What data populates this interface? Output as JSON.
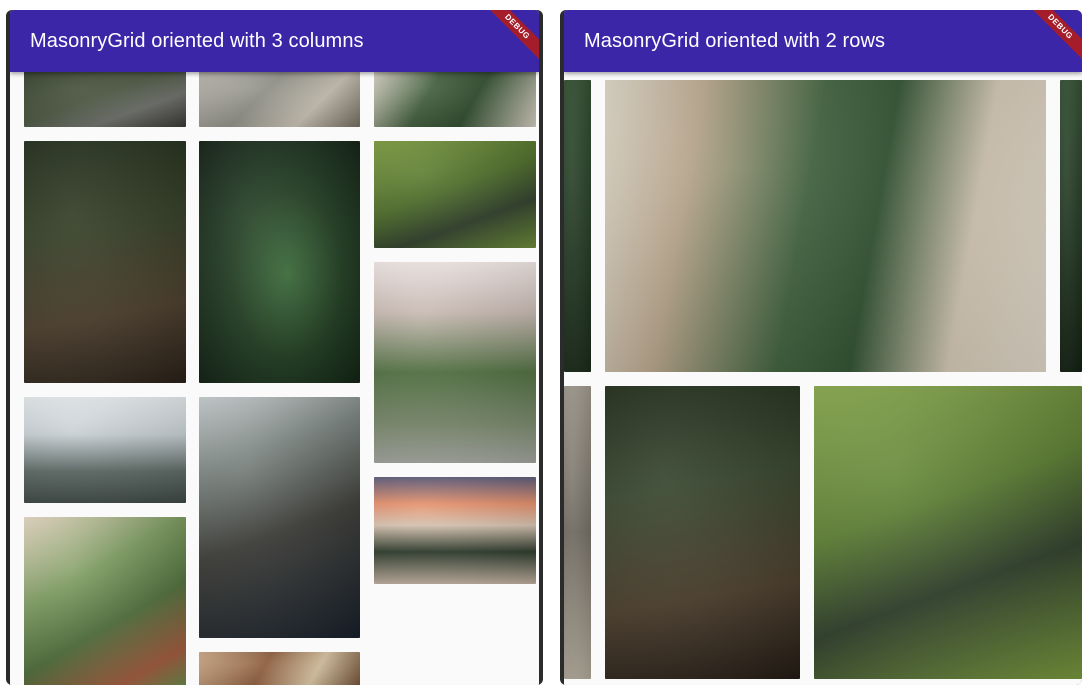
{
  "left_phone": {
    "appbar": {
      "title": "MasonryGrid oriented with 3 columns"
    },
    "debug_banner": "DEBUG",
    "tiles": [
      {
        "id": "road",
        "icon": "photo-road"
      },
      {
        "id": "hiker",
        "icon": "photo-hiker"
      },
      {
        "id": "shelf-plants",
        "icon": "photo-shelf-plants"
      },
      {
        "id": "motorbike",
        "icon": "photo-motorbike"
      },
      {
        "id": "fern",
        "icon": "photo-fern"
      },
      {
        "id": "green-valley",
        "icon": "photo-green-valley"
      },
      {
        "id": "flowers-fence",
        "icon": "photo-flowers-fence"
      },
      {
        "id": "foggy-forest",
        "icon": "photo-foggy-forest"
      },
      {
        "id": "photographer",
        "icon": "photo-photographer"
      },
      {
        "id": "campervan",
        "icon": "photo-campervan"
      },
      {
        "id": "cactus",
        "icon": "photo-cactus"
      },
      {
        "id": "food",
        "icon": "photo-food"
      }
    ]
  },
  "right_phone": {
    "appbar": {
      "title": "MasonryGrid oriented with 2 rows"
    },
    "debug_banner": "DEBUG",
    "tiles": [
      {
        "id": "strip-left",
        "icon": "photo-strip"
      },
      {
        "id": "shelf-plants",
        "icon": "photo-shelf-plants"
      },
      {
        "id": "strip-right",
        "icon": "photo-strip"
      },
      {
        "id": "rock-strip",
        "icon": "photo-rock"
      },
      {
        "id": "motorbike",
        "icon": "photo-motorbike"
      },
      {
        "id": "green-valley",
        "icon": "photo-green-valley"
      }
    ]
  },
  "colors": {
    "appbar": "#3b26a8",
    "debug": "#a51d2a",
    "background": "#fafafa"
  }
}
